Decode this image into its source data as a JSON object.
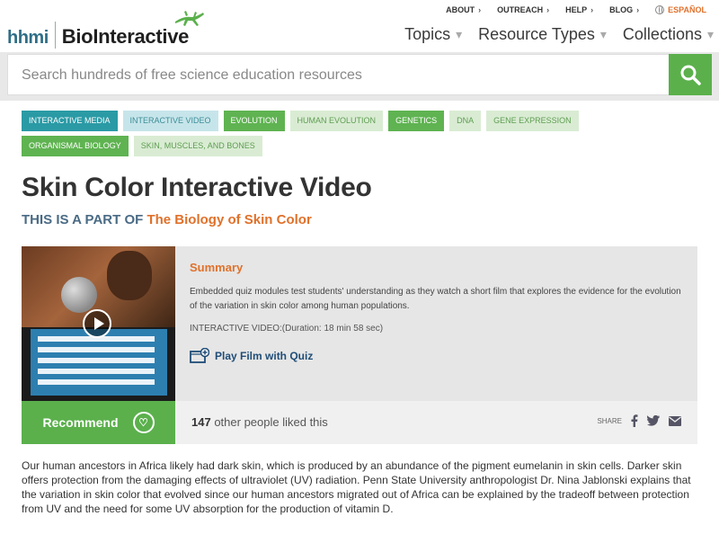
{
  "brand": {
    "org": "hhmi",
    "name": "BioInteractive"
  },
  "utility_nav": [
    {
      "label": "ABOUT"
    },
    {
      "label": "OUTREACH"
    },
    {
      "label": "HELP"
    },
    {
      "label": "BLOG"
    }
  ],
  "language": {
    "label": "ESPAÑOL"
  },
  "main_nav": [
    {
      "label": "Topics"
    },
    {
      "label": "Resource Types"
    },
    {
      "label": "Collections"
    }
  ],
  "search": {
    "placeholder": "Search hundreds of free science education resources"
  },
  "tags_row1": [
    "INTERACTIVE MEDIA",
    "INTERACTIVE VIDEO",
    "EVOLUTION",
    "HUMAN EVOLUTION",
    "GENETICS",
    "DNA",
    "GENE EXPRESSION"
  ],
  "tags_row2": [
    "ORGANISMAL BIOLOGY",
    "SKIN, MUSCLES, AND BONES"
  ],
  "page": {
    "title": "Skin Color Interactive Video",
    "part_of_prefix": "THIS IS A PART OF",
    "part_of_link": "The Biology of Skin Color"
  },
  "summary": {
    "heading": "Summary",
    "text": "Embedded quiz modules test students' understanding as they watch a short film that explores the evidence for the evolution of the variation in skin color among human populations.",
    "duration": "INTERACTIVE VIDEO:(Duration: 18 min 58 sec)",
    "play_label": "Play Film with Quiz"
  },
  "recommend": {
    "label": "Recommend",
    "count": "147",
    "suffix": "other people liked this",
    "share_label": "SHARE"
  },
  "description": "Our human ancestors in Africa likely had dark skin, which is produced by an abundance of the pigment eumelanin in skin cells. Darker skin offers protection from the damaging effects of ultraviolet (UV) radiation. Penn State University anthropologist Dr. Nina Jablonski explains that the variation in skin color that evolved since our human ancestors migrated out of Africa can be explained by the tradeoff between protection from UV and the need for some UV absorption for the production of vitamin D.",
  "colors": {
    "accent_orange": "#e0712b",
    "green": "#5bb04c",
    "teal": "#2a9aa5"
  }
}
